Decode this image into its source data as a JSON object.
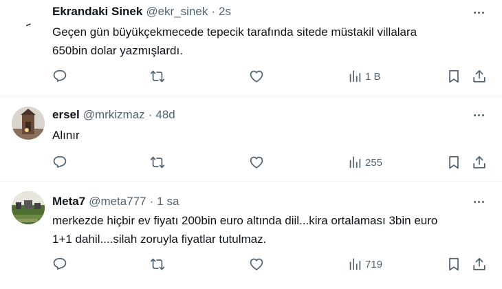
{
  "tweets": [
    {
      "name": "Ekrandaki Sinek",
      "handle": "@ekr_sinek",
      "separator": "·",
      "time": "2s",
      "text_lines": [
        "Geçen gün büyükçekmecede tepecik tarafında sitede müstakil villalara",
        "650bin dolar yazmışlardı."
      ],
      "views": "1 B"
    },
    {
      "name": "ersel",
      "handle": "@mrkizmaz",
      "separator": "·",
      "time": "48d",
      "text_lines": [
        "Alınır"
      ],
      "views": "255"
    },
    {
      "name": "Meta7",
      "handle": "@meta777",
      "separator": "·",
      "time": "1 sa",
      "text_lines": [
        "merkezde hiçbir ev fiyatı 200bin euro altında diil...kira ortalaması 3bin euro",
        "1+1 dahil....silah zoruyla fiyatlar tutulmaz."
      ],
      "views": "719"
    }
  ],
  "icons": {
    "reply": "reply-icon",
    "retweet": "retweet-icon",
    "like": "heart-icon",
    "views": "views-chart-icon",
    "bookmark": "bookmark-icon",
    "share": "share-icon",
    "more": "more-dots-icon"
  },
  "colors": {
    "text": "#0f1419",
    "secondary": "#536471",
    "divider": "#eff3f4"
  }
}
